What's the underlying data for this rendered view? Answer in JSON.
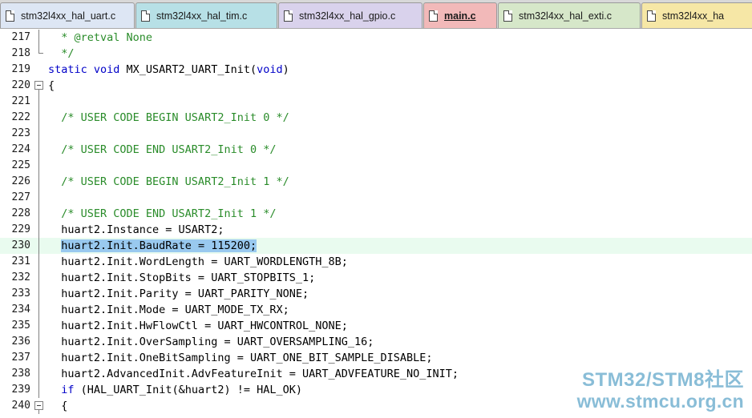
{
  "tabs": [
    {
      "label": "stm32l4xx_hal_uart.c",
      "color": "#dde6f4",
      "active": false
    },
    {
      "label": "stm32l4xx_hal_tim.c",
      "color": "#b7e0e6",
      "active": false
    },
    {
      "label": "stm32l4xx_hal_gpio.c",
      "color": "#d9d2ec",
      "active": false
    },
    {
      "label": "main.c",
      "color": "#f2b9b9",
      "active": true
    },
    {
      "label": "stm32l4xx_hal_exti.c",
      "color": "#d6e7c9",
      "active": false
    },
    {
      "label": "stm32l4xx_ha",
      "color": "#f6e7a6",
      "active": false
    }
  ],
  "editor": {
    "current_line": "230",
    "lines": [
      {
        "num": "217",
        "fold": "line",
        "tokens": [
          {
            "t": "  * @retval None",
            "c": "comment"
          }
        ]
      },
      {
        "num": "218",
        "fold": "end",
        "tokens": [
          {
            "t": "  */",
            "c": "comment"
          }
        ]
      },
      {
        "num": "219",
        "fold": "",
        "tokens": [
          {
            "t": "static void",
            "c": "keyword"
          },
          {
            "t": " MX_USART2_UART_Init(",
            "c": "plain"
          },
          {
            "t": "void",
            "c": "keyword"
          },
          {
            "t": ")",
            "c": "plain"
          }
        ]
      },
      {
        "num": "220",
        "fold": "box",
        "tokens": [
          {
            "t": "{",
            "c": "plain"
          }
        ]
      },
      {
        "num": "221",
        "fold": "line",
        "tokens": []
      },
      {
        "num": "222",
        "fold": "line",
        "tokens": [
          {
            "t": "  /* USER CODE BEGIN USART2_Init 0 */",
            "c": "comment"
          }
        ]
      },
      {
        "num": "223",
        "fold": "line",
        "tokens": []
      },
      {
        "num": "224",
        "fold": "line",
        "tokens": [
          {
            "t": "  /* USER CODE END USART2_Init 0 */",
            "c": "comment"
          }
        ]
      },
      {
        "num": "225",
        "fold": "line",
        "tokens": []
      },
      {
        "num": "226",
        "fold": "line",
        "tokens": [
          {
            "t": "  /* USER CODE BEGIN USART2_Init 1 */",
            "c": "comment"
          }
        ]
      },
      {
        "num": "227",
        "fold": "line",
        "tokens": []
      },
      {
        "num": "228",
        "fold": "line",
        "tokens": [
          {
            "t": "  /* USER CODE END USART2_Init 1 */",
            "c": "comment"
          }
        ]
      },
      {
        "num": "229",
        "fold": "line",
        "tokens": [
          {
            "t": "  huart2.Instance = USART2;",
            "c": "plain"
          }
        ]
      },
      {
        "num": "230",
        "fold": "line",
        "tokens": [
          {
            "t": "  ",
            "c": "plain"
          },
          {
            "t": "huart2.Init.BaudRate = 115200;",
            "c": "selected"
          }
        ]
      },
      {
        "num": "231",
        "fold": "line",
        "tokens": [
          {
            "t": "  huart2.Init.WordLength = UART_WORDLENGTH_8B;",
            "c": "plain"
          }
        ]
      },
      {
        "num": "232",
        "fold": "line",
        "tokens": [
          {
            "t": "  huart2.Init.StopBits = UART_STOPBITS_1;",
            "c": "plain"
          }
        ]
      },
      {
        "num": "233",
        "fold": "line",
        "tokens": [
          {
            "t": "  huart2.Init.Parity = UART_PARITY_NONE;",
            "c": "plain"
          }
        ]
      },
      {
        "num": "234",
        "fold": "line",
        "tokens": [
          {
            "t": "  huart2.Init.Mode = UART_MODE_TX_RX;",
            "c": "plain"
          }
        ]
      },
      {
        "num": "235",
        "fold": "line",
        "tokens": [
          {
            "t": "  huart2.Init.HwFlowCtl = UART_HWCONTROL_NONE;",
            "c": "plain"
          }
        ]
      },
      {
        "num": "236",
        "fold": "line",
        "tokens": [
          {
            "t": "  huart2.Init.OverSampling = UART_OVERSAMPLING_16;",
            "c": "plain"
          }
        ]
      },
      {
        "num": "237",
        "fold": "line",
        "tokens": [
          {
            "t": "  huart2.Init.OneBitSampling = UART_ONE_BIT_SAMPLE_DISABLE;",
            "c": "plain"
          }
        ]
      },
      {
        "num": "238",
        "fold": "line",
        "tokens": [
          {
            "t": "  huart2.AdvancedInit.AdvFeatureInit = UART_ADVFEATURE_NO_INIT;",
            "c": "plain"
          }
        ]
      },
      {
        "num": "239",
        "fold": "line",
        "tokens": [
          {
            "t": "  ",
            "c": "plain"
          },
          {
            "t": "if",
            "c": "keyword"
          },
          {
            "t": " (HAL_UART_Init(&huart2) != HAL_OK)",
            "c": "plain"
          }
        ]
      },
      {
        "num": "240",
        "fold": "box",
        "tokens": [
          {
            "t": "  {",
            "c": "plain"
          }
        ]
      }
    ]
  },
  "watermark": {
    "line1": "STM32/STM8社区",
    "line2": "www.stmcu.org.cn"
  },
  "colors": {
    "keyword": "#0000c8",
    "comment": "#2a8c2a",
    "selection": "#99c9ef",
    "current_line_bg": "#e9fbef",
    "watermark": "#7fb8d4"
  }
}
